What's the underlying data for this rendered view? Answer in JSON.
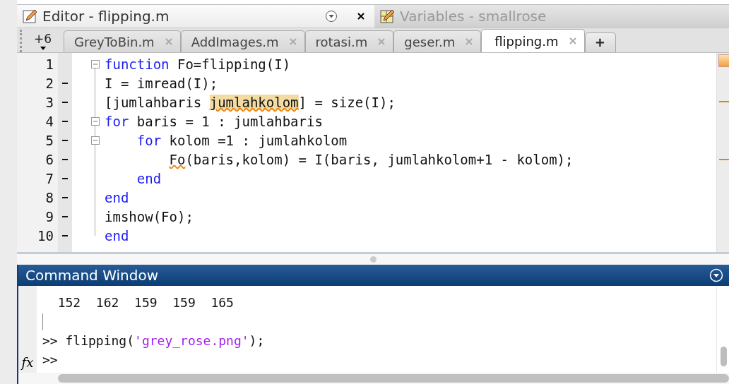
{
  "panels": [
    {
      "title": "Editor - flipping.m",
      "selected": true,
      "kind": "editor"
    },
    {
      "title": "Variables - smallrose",
      "selected": false,
      "kind": "variables"
    }
  ],
  "editor": {
    "overflow": "+6",
    "add": "+",
    "tabs": [
      {
        "label": "GreyToBin.m",
        "selected": false
      },
      {
        "label": "AddImages.m",
        "selected": false
      },
      {
        "label": "rotasi.m",
        "selected": false
      },
      {
        "label": "geser.m",
        "selected": false
      },
      {
        "label": "flipping.m",
        "selected": true
      }
    ],
    "lines": [
      {
        "number": "1",
        "executable": false,
        "collapsible": true,
        "tokens": [
          {
            "kind": "keyword",
            "text": "function"
          },
          {
            "kind": "plain",
            "text": " Fo=flipping(I)"
          }
        ]
      },
      {
        "number": "2",
        "executable": true,
        "collapsible": false,
        "tokens": [
          {
            "kind": "plain",
            "text": "I = imread(I);"
          }
        ]
      },
      {
        "number": "3",
        "executable": true,
        "collapsible": false,
        "tokens": [
          {
            "kind": "plain",
            "text": "[jumlahbaris "
          },
          {
            "kind": "highlight",
            "text": "jumlahkolom"
          },
          {
            "kind": "plain",
            "text": "] = size(I);"
          }
        ]
      },
      {
        "number": "4",
        "executable": true,
        "collapsible": true,
        "tokens": [
          {
            "kind": "keyword",
            "text": "for"
          },
          {
            "kind": "plain",
            "text": " baris = 1 : jumlahbaris"
          }
        ]
      },
      {
        "number": "5",
        "executable": true,
        "collapsible": true,
        "tokens": [
          {
            "kind": "keyword",
            "text": "    for"
          },
          {
            "kind": "plain",
            "text": " kolom =1 : jumlahkolom"
          }
        ]
      },
      {
        "number": "6",
        "executable": true,
        "collapsible": false,
        "tokens": [
          {
            "kind": "warning",
            "text": "        Fo"
          },
          {
            "kind": "plain",
            "text": "(baris,kolom) = I(baris, jumlahkolom+1 - kolom);"
          }
        ]
      },
      {
        "number": "7",
        "executable": true,
        "collapsible": false,
        "tokens": [
          {
            "kind": "keyword",
            "text": "    end"
          }
        ]
      },
      {
        "number": "8",
        "executable": true,
        "collapsible": false,
        "tokens": [
          {
            "kind": "keyword",
            "text": "end"
          }
        ]
      },
      {
        "number": "9",
        "executable": true,
        "collapsible": false,
        "tokens": [
          {
            "kind": "plain",
            "text": "imshow(Fo);"
          }
        ]
      },
      {
        "number": "10",
        "executable": true,
        "collapsible": false,
        "tokens": [
          {
            "kind": "keyword",
            "text": "end"
          }
        ]
      }
    ]
  },
  "command_window": {
    "title": "Command Window",
    "output": "  152  162  159  159  165",
    "history": [
      {
        "kind": "plain",
        "text": ">> flipping("
      },
      {
        "kind": "string",
        "text": "'grey_rose.png'"
      },
      {
        "kind": "plain",
        "text": ");"
      }
    ],
    "prompt": ">>",
    "function_button": "fx"
  }
}
